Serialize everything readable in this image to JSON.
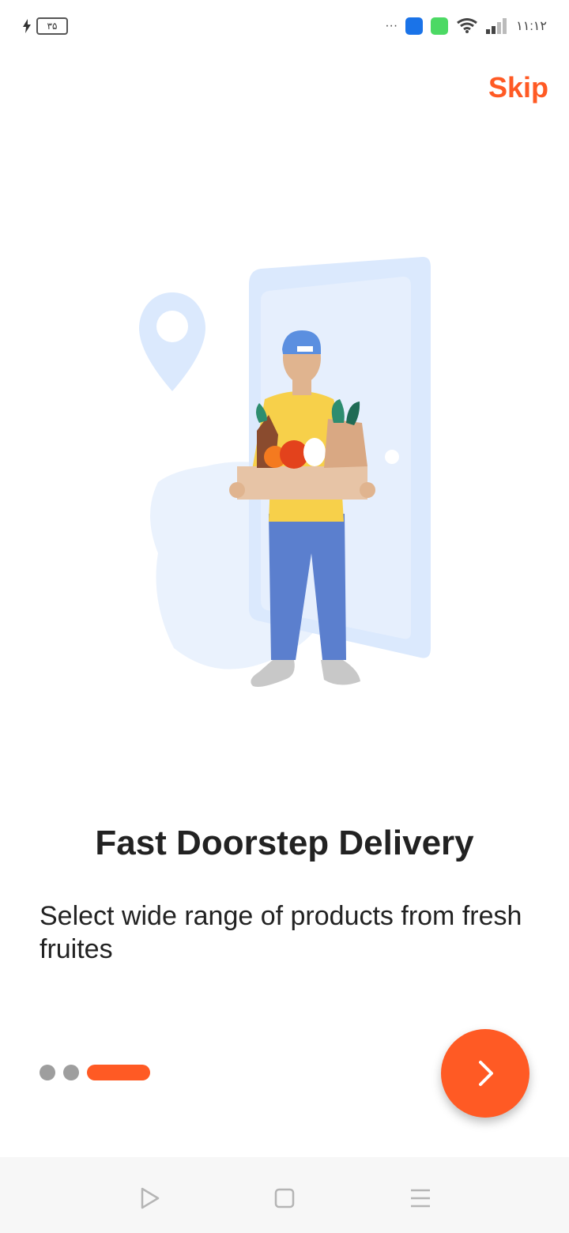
{
  "status_bar": {
    "battery_level": "۳۵",
    "time": "۱۱:۱۲",
    "overflow": "···"
  },
  "onboarding": {
    "skip_label": "Skip",
    "title": "Fast Doorstep Delivery",
    "subtitle": "Select wide range of products from fresh fruites",
    "page_indicator": {
      "total": 3,
      "active_index": 2
    },
    "next_icon": "chevron-right-icon"
  },
  "colors": {
    "accent": "#ff5a24",
    "inactive_dot": "#9e9e9e",
    "illustration_blue": "#dbe9fd",
    "nav_bar_bg": "#f7f7f7"
  },
  "nav_bar": {
    "icons": [
      "back-triangle-icon",
      "home-square-icon",
      "menu-lines-icon"
    ]
  }
}
